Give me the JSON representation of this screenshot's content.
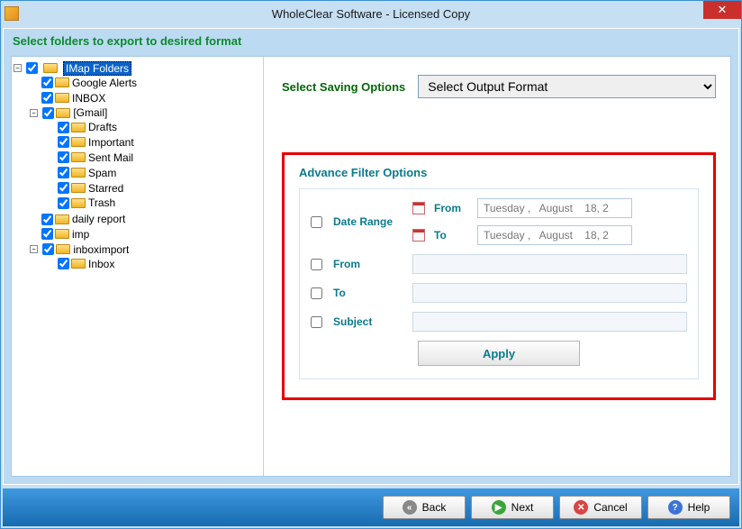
{
  "window": {
    "title": "WholeClear Software - Licensed Copy",
    "close_glyph": "✕"
  },
  "subtitle": "Select folders to export to desired format",
  "tree": {
    "root": "IMap Folders",
    "google_alerts": "Google Alerts",
    "inbox": "INBOX",
    "gmail": "[Gmail]",
    "drafts": "Drafts",
    "important": "Important",
    "sent_mail": "Sent Mail",
    "spam": "Spam",
    "starred": "Starred",
    "trash": "Trash",
    "daily_report": "daily report",
    "imp": "imp",
    "inboximport": "inboximport",
    "inbox2": "Inbox"
  },
  "saving": {
    "label": "Select Saving Options",
    "selected": "Select Output Format"
  },
  "filter": {
    "title": "Advance Filter Options",
    "date_range": "Date Range",
    "from_sub": "From",
    "to_sub": "To",
    "date_from": "Tuesday ,   August    18, 2",
    "date_to": "Tuesday ,   August    18, 2",
    "from": "From",
    "to": "To",
    "subject": "Subject",
    "apply": "Apply"
  },
  "footer": {
    "back": "Back",
    "next": "Next",
    "cancel": "Cancel",
    "help": "Help"
  },
  "expander": {
    "minus": "−"
  }
}
